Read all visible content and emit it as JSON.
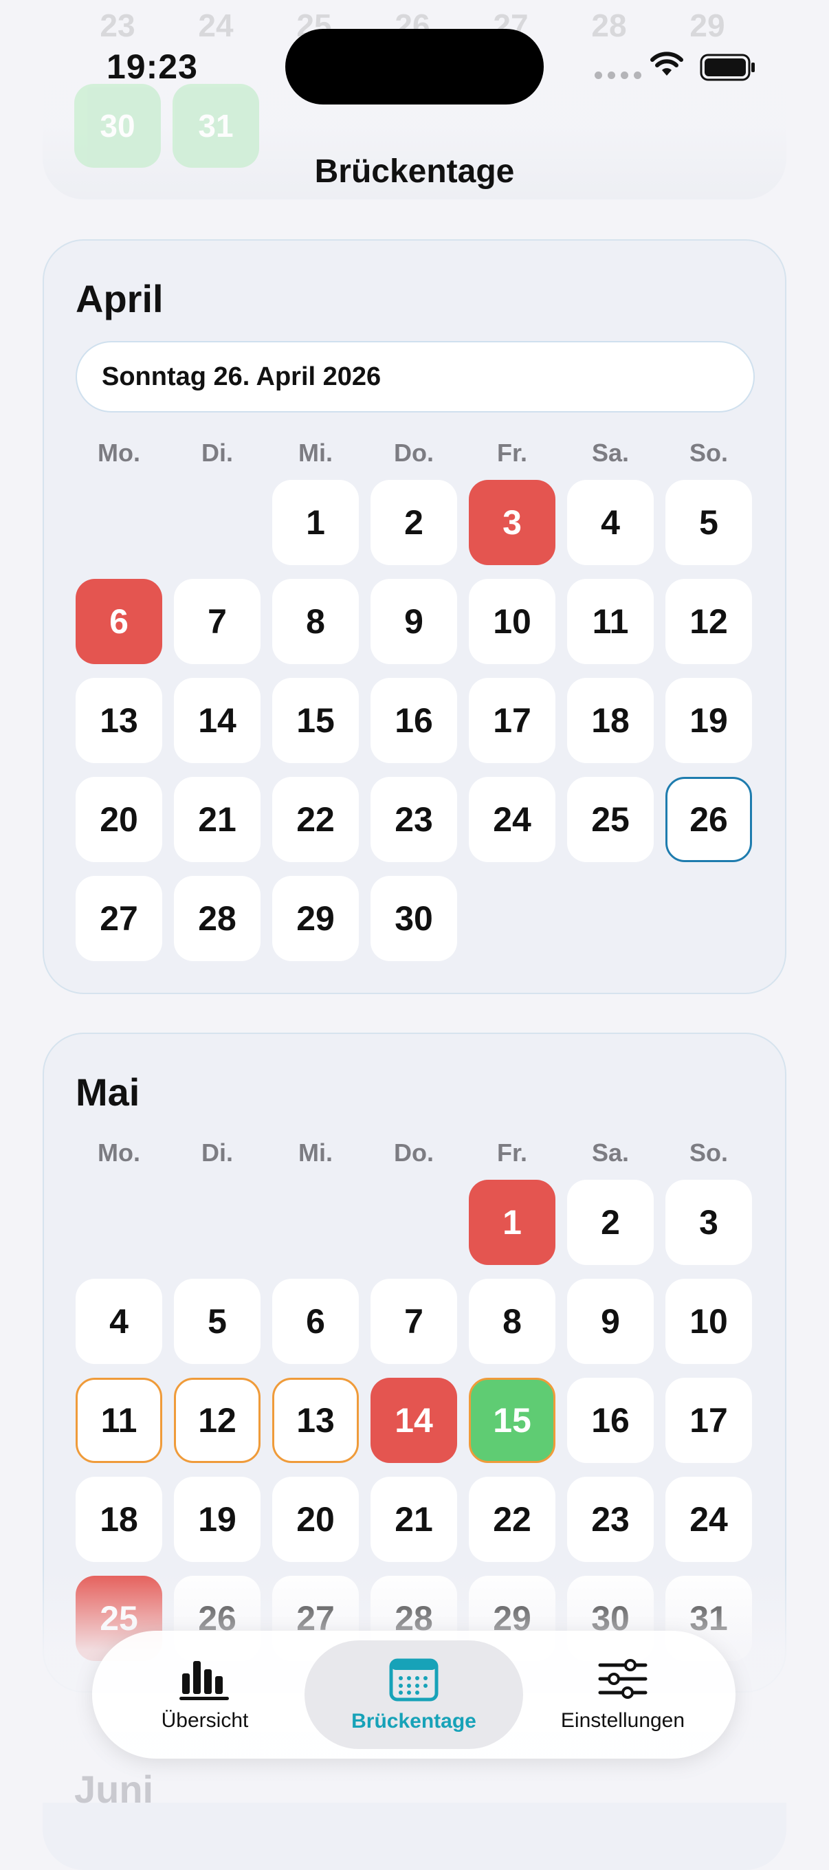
{
  "status_bar": {
    "time": "19:23"
  },
  "nav": {
    "title": "Brückentage"
  },
  "prev_month_partial": {
    "days": [
      "23",
      "24",
      "25",
      "26",
      "27",
      "28",
      "29",
      "30",
      "31"
    ]
  },
  "months": [
    {
      "name": "April",
      "selected_date": "Sonntag 26. April 2026",
      "weekdays": [
        "Mo.",
        "Di.",
        "Mi.",
        "Do.",
        "Fr.",
        "Sa.",
        "So."
      ],
      "days": [
        {
          "d": "1",
          "type": "normal"
        },
        {
          "d": "2",
          "type": "normal"
        },
        {
          "d": "3",
          "type": "holiday"
        },
        {
          "d": "4",
          "type": "normal"
        },
        {
          "d": "5",
          "type": "normal"
        },
        {
          "d": "6",
          "type": "holiday"
        },
        {
          "d": "7",
          "type": "normal"
        },
        {
          "d": "8",
          "type": "normal"
        },
        {
          "d": "9",
          "type": "normal"
        },
        {
          "d": "10",
          "type": "normal"
        },
        {
          "d": "11",
          "type": "normal"
        },
        {
          "d": "12",
          "type": "normal"
        },
        {
          "d": "13",
          "type": "normal"
        },
        {
          "d": "14",
          "type": "normal"
        },
        {
          "d": "15",
          "type": "normal"
        },
        {
          "d": "16",
          "type": "normal"
        },
        {
          "d": "17",
          "type": "normal"
        },
        {
          "d": "18",
          "type": "normal"
        },
        {
          "d": "19",
          "type": "normal"
        },
        {
          "d": "20",
          "type": "normal"
        },
        {
          "d": "21",
          "type": "normal"
        },
        {
          "d": "22",
          "type": "normal"
        },
        {
          "d": "23",
          "type": "normal"
        },
        {
          "d": "24",
          "type": "normal"
        },
        {
          "d": "25",
          "type": "normal"
        },
        {
          "d": "26",
          "type": "today"
        },
        {
          "d": "27",
          "type": "normal"
        },
        {
          "d": "28",
          "type": "normal"
        },
        {
          "d": "29",
          "type": "normal"
        },
        {
          "d": "30",
          "type": "normal"
        }
      ]
    },
    {
      "name": "Mai",
      "weekdays": [
        "Mo.",
        "Di.",
        "Mi.",
        "Do.",
        "Fr.",
        "Sa.",
        "So."
      ],
      "days": [
        {
          "d": "1",
          "type": "holiday"
        },
        {
          "d": "2",
          "type": "normal"
        },
        {
          "d": "3",
          "type": "normal"
        },
        {
          "d": "4",
          "type": "normal"
        },
        {
          "d": "5",
          "type": "normal"
        },
        {
          "d": "6",
          "type": "normal"
        },
        {
          "d": "7",
          "type": "normal"
        },
        {
          "d": "8",
          "type": "normal"
        },
        {
          "d": "9",
          "type": "normal"
        },
        {
          "d": "10",
          "type": "normal"
        },
        {
          "d": "11",
          "type": "bridge"
        },
        {
          "d": "12",
          "type": "bridge"
        },
        {
          "d": "13",
          "type": "bridge"
        },
        {
          "d": "14",
          "type": "holiday"
        },
        {
          "d": "15",
          "type": "green"
        },
        {
          "d": "16",
          "type": "normal"
        },
        {
          "d": "17",
          "type": "normal"
        },
        {
          "d": "18",
          "type": "normal"
        },
        {
          "d": "19",
          "type": "normal"
        },
        {
          "d": "20",
          "type": "normal"
        },
        {
          "d": "21",
          "type": "normal"
        },
        {
          "d": "22",
          "type": "normal"
        },
        {
          "d": "23",
          "type": "normal"
        },
        {
          "d": "24",
          "type": "normal"
        },
        {
          "d": "25",
          "type": "holiday"
        },
        {
          "d": "26",
          "type": "normal"
        },
        {
          "d": "27",
          "type": "normal"
        },
        {
          "d": "28",
          "type": "normal"
        },
        {
          "d": "29",
          "type": "normal"
        },
        {
          "d": "30",
          "type": "normal"
        },
        {
          "d": "31",
          "type": "normal"
        }
      ]
    }
  ],
  "next_month_partial": {
    "name": "Juni"
  },
  "tabbar": {
    "tabs": [
      {
        "label": "Übersicht",
        "icon": "bar-chart-icon",
        "active": false
      },
      {
        "label": "Brückentage",
        "icon": "calendar-icon",
        "active": true
      },
      {
        "label": "Einstellungen",
        "icon": "sliders-icon",
        "active": false
      }
    ]
  },
  "colors": {
    "holiday": "#e45550",
    "bridge_border": "#ef9b3a",
    "free_day": "#5fcc73",
    "today_border": "#1e7cae",
    "accent": "#17a2b8"
  }
}
